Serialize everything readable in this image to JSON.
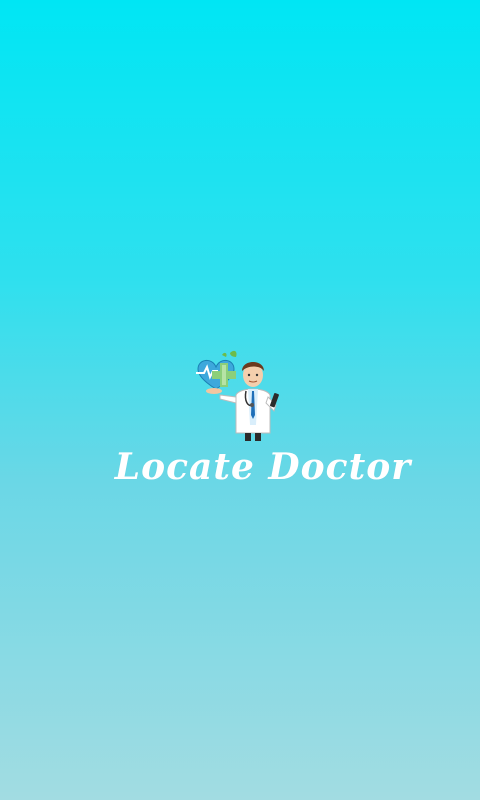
{
  "app": {
    "title": "Locate Doctor"
  },
  "logo": {
    "icon": "doctor-heart-icon"
  },
  "colors": {
    "background_top": "#00e6f4",
    "background_bottom": "#a2dce2",
    "title_text": "#ffffff"
  }
}
